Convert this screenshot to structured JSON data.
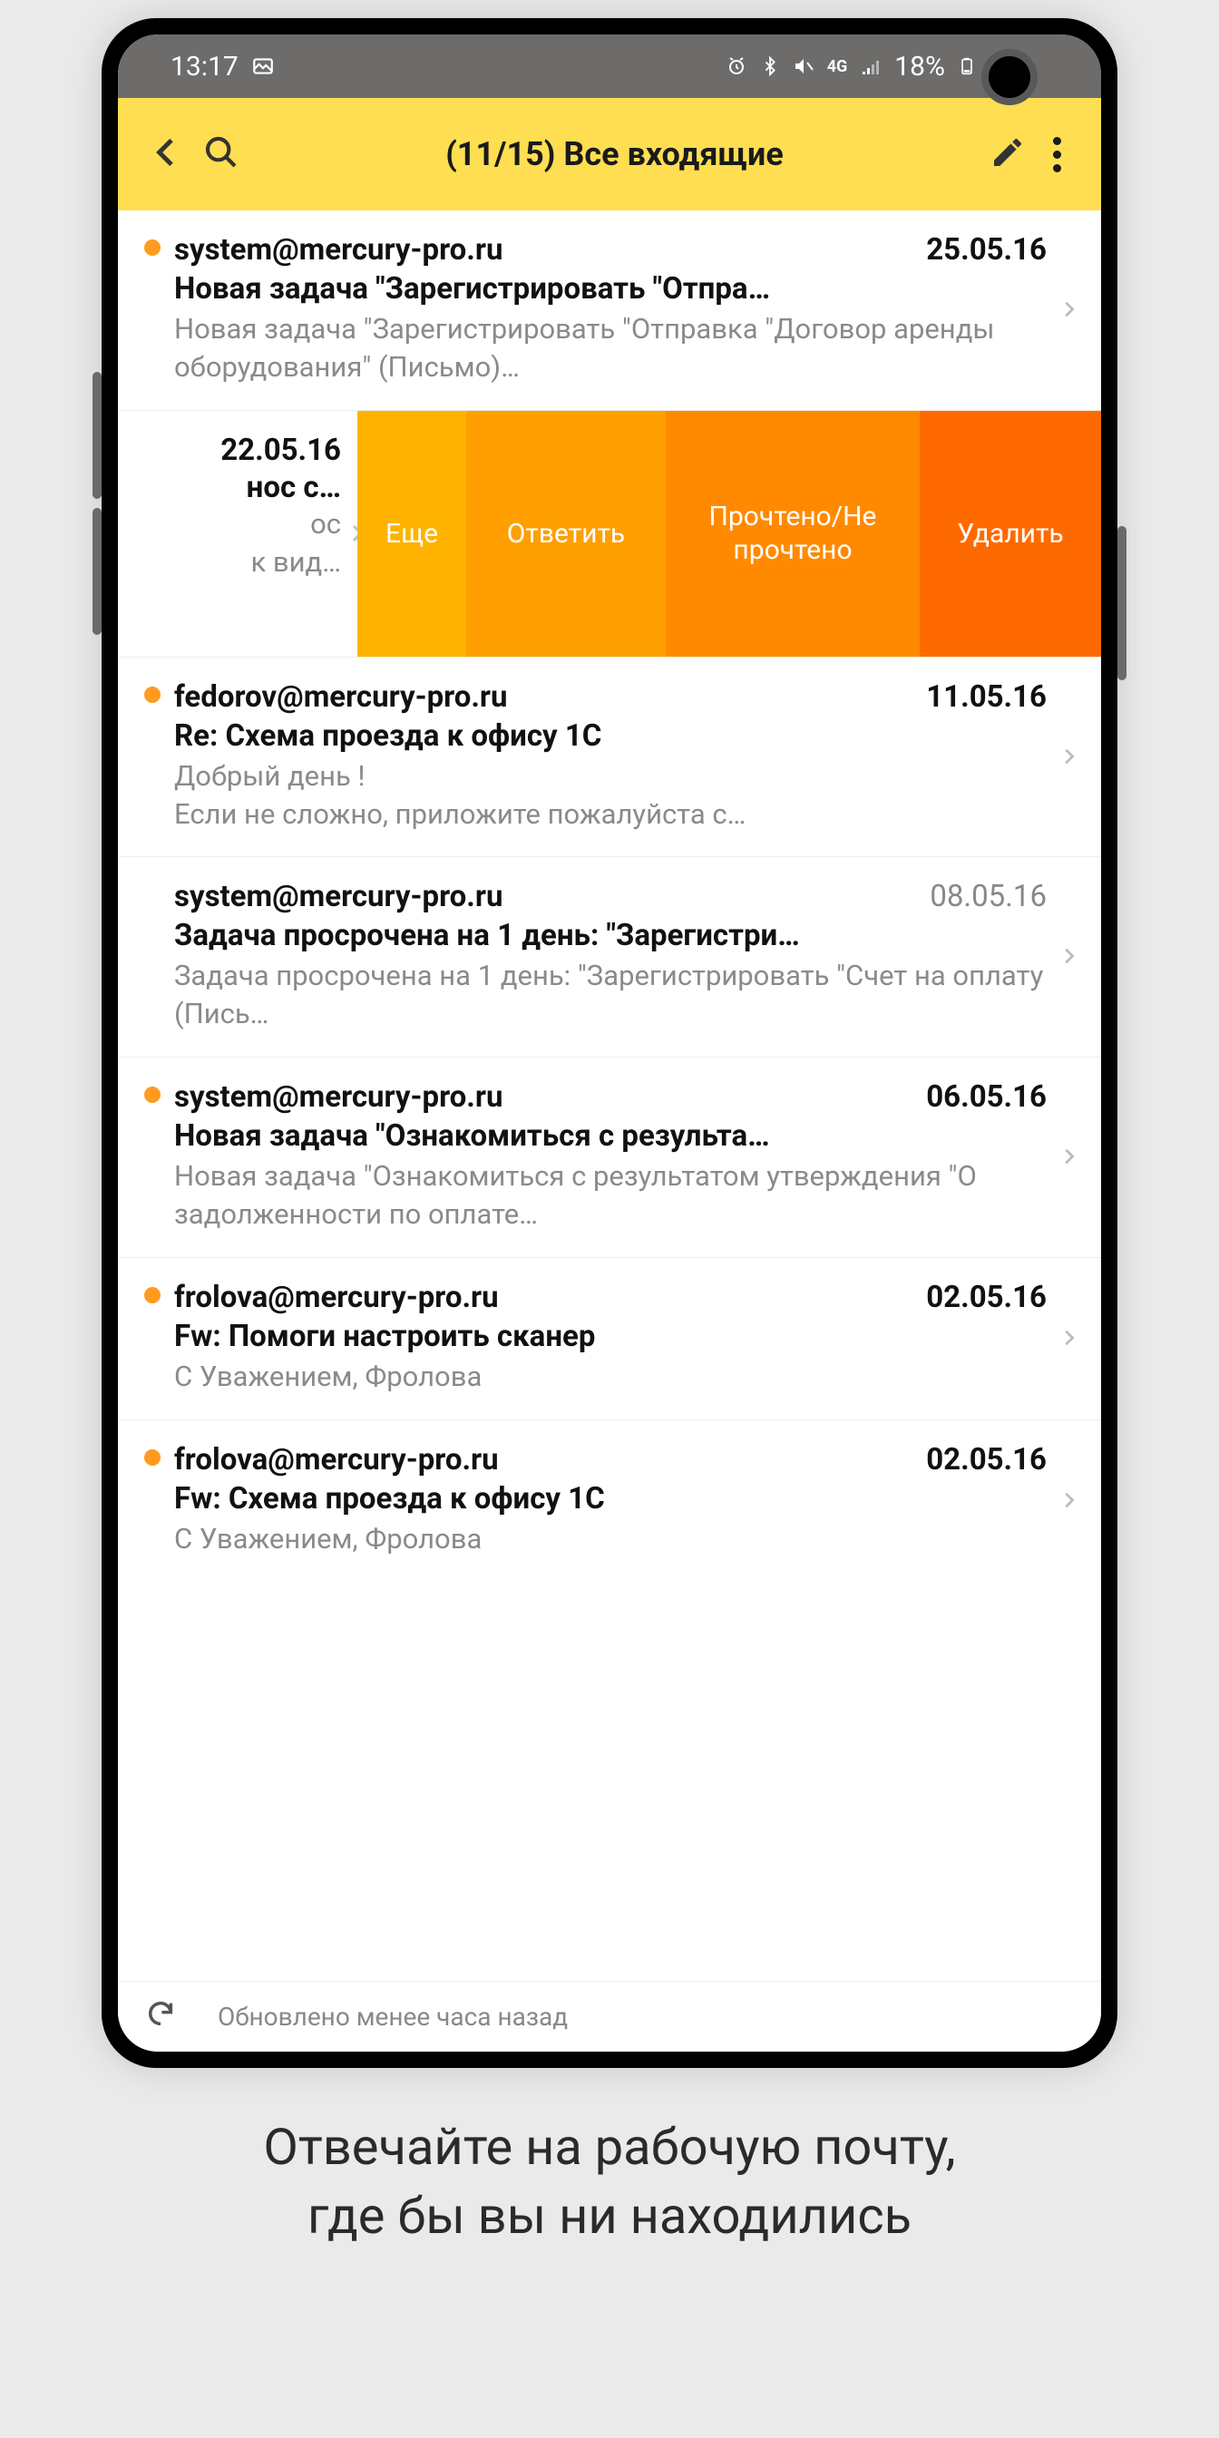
{
  "statusbar": {
    "time": "13:17",
    "battery": "18%"
  },
  "appbar": {
    "title": "(11/15) Все входящие"
  },
  "swipe_actions": {
    "more": "Еще",
    "reply": "Ответить",
    "toggle_read": "Прочтено/Не прочтено",
    "delete": "Удалить"
  },
  "swiped_item": {
    "date": "22.05.16",
    "subject_tail": "нос с…",
    "preview_tail1": "ос",
    "preview_tail2": "к вид…"
  },
  "emails": [
    {
      "unread": true,
      "sender": "system@mercury-pro.ru",
      "date": "25.05.16",
      "subject": "Новая задача \"Зарегистрировать \"Отпра…",
      "preview": "Новая задача \"Зарегистрировать \"Отправка \"Договор аренды оборудования\" (Письмо)…"
    },
    {
      "unread": true,
      "sender": "fedorov@mercury-pro.ru",
      "date": "11.05.16",
      "subject": "Re: Схема проезда к офису 1С",
      "preview": "Добрый день !\nЕсли не сложно, приложите пожалуйста с…"
    },
    {
      "unread": false,
      "sender": "system@mercury-pro.ru",
      "date": "08.05.16",
      "subject": "Задача просрочена на 1 день: \"Зарегистри…",
      "preview": "Задача просрочена на 1 день: \"Зарегистрировать \"Счет на оплату (Пись…"
    },
    {
      "unread": true,
      "sender": "system@mercury-pro.ru",
      "date": "06.05.16",
      "subject": "Новая задача \"Ознакомиться с результа…",
      "preview": "Новая задача \"Ознакомиться с результатом утверждения \"О задолженности по оплате…"
    },
    {
      "unread": true,
      "sender": "frolova@mercury-pro.ru",
      "date": "02.05.16",
      "subject": "Fw: Помоги настроить сканер",
      "preview": "С Уважением, Фролова"
    },
    {
      "unread": true,
      "sender": "frolova@mercury-pro.ru",
      "date": "02.05.16",
      "subject": "Fw: Схема проезда к офису 1С",
      "preview": "С Уважением, Фролова"
    }
  ],
  "refresh": {
    "text": "Обновлено менее часа назад"
  },
  "caption": {
    "line1": "Отвечайте на рабочую почту,",
    "line2": "где бы вы ни находились"
  }
}
